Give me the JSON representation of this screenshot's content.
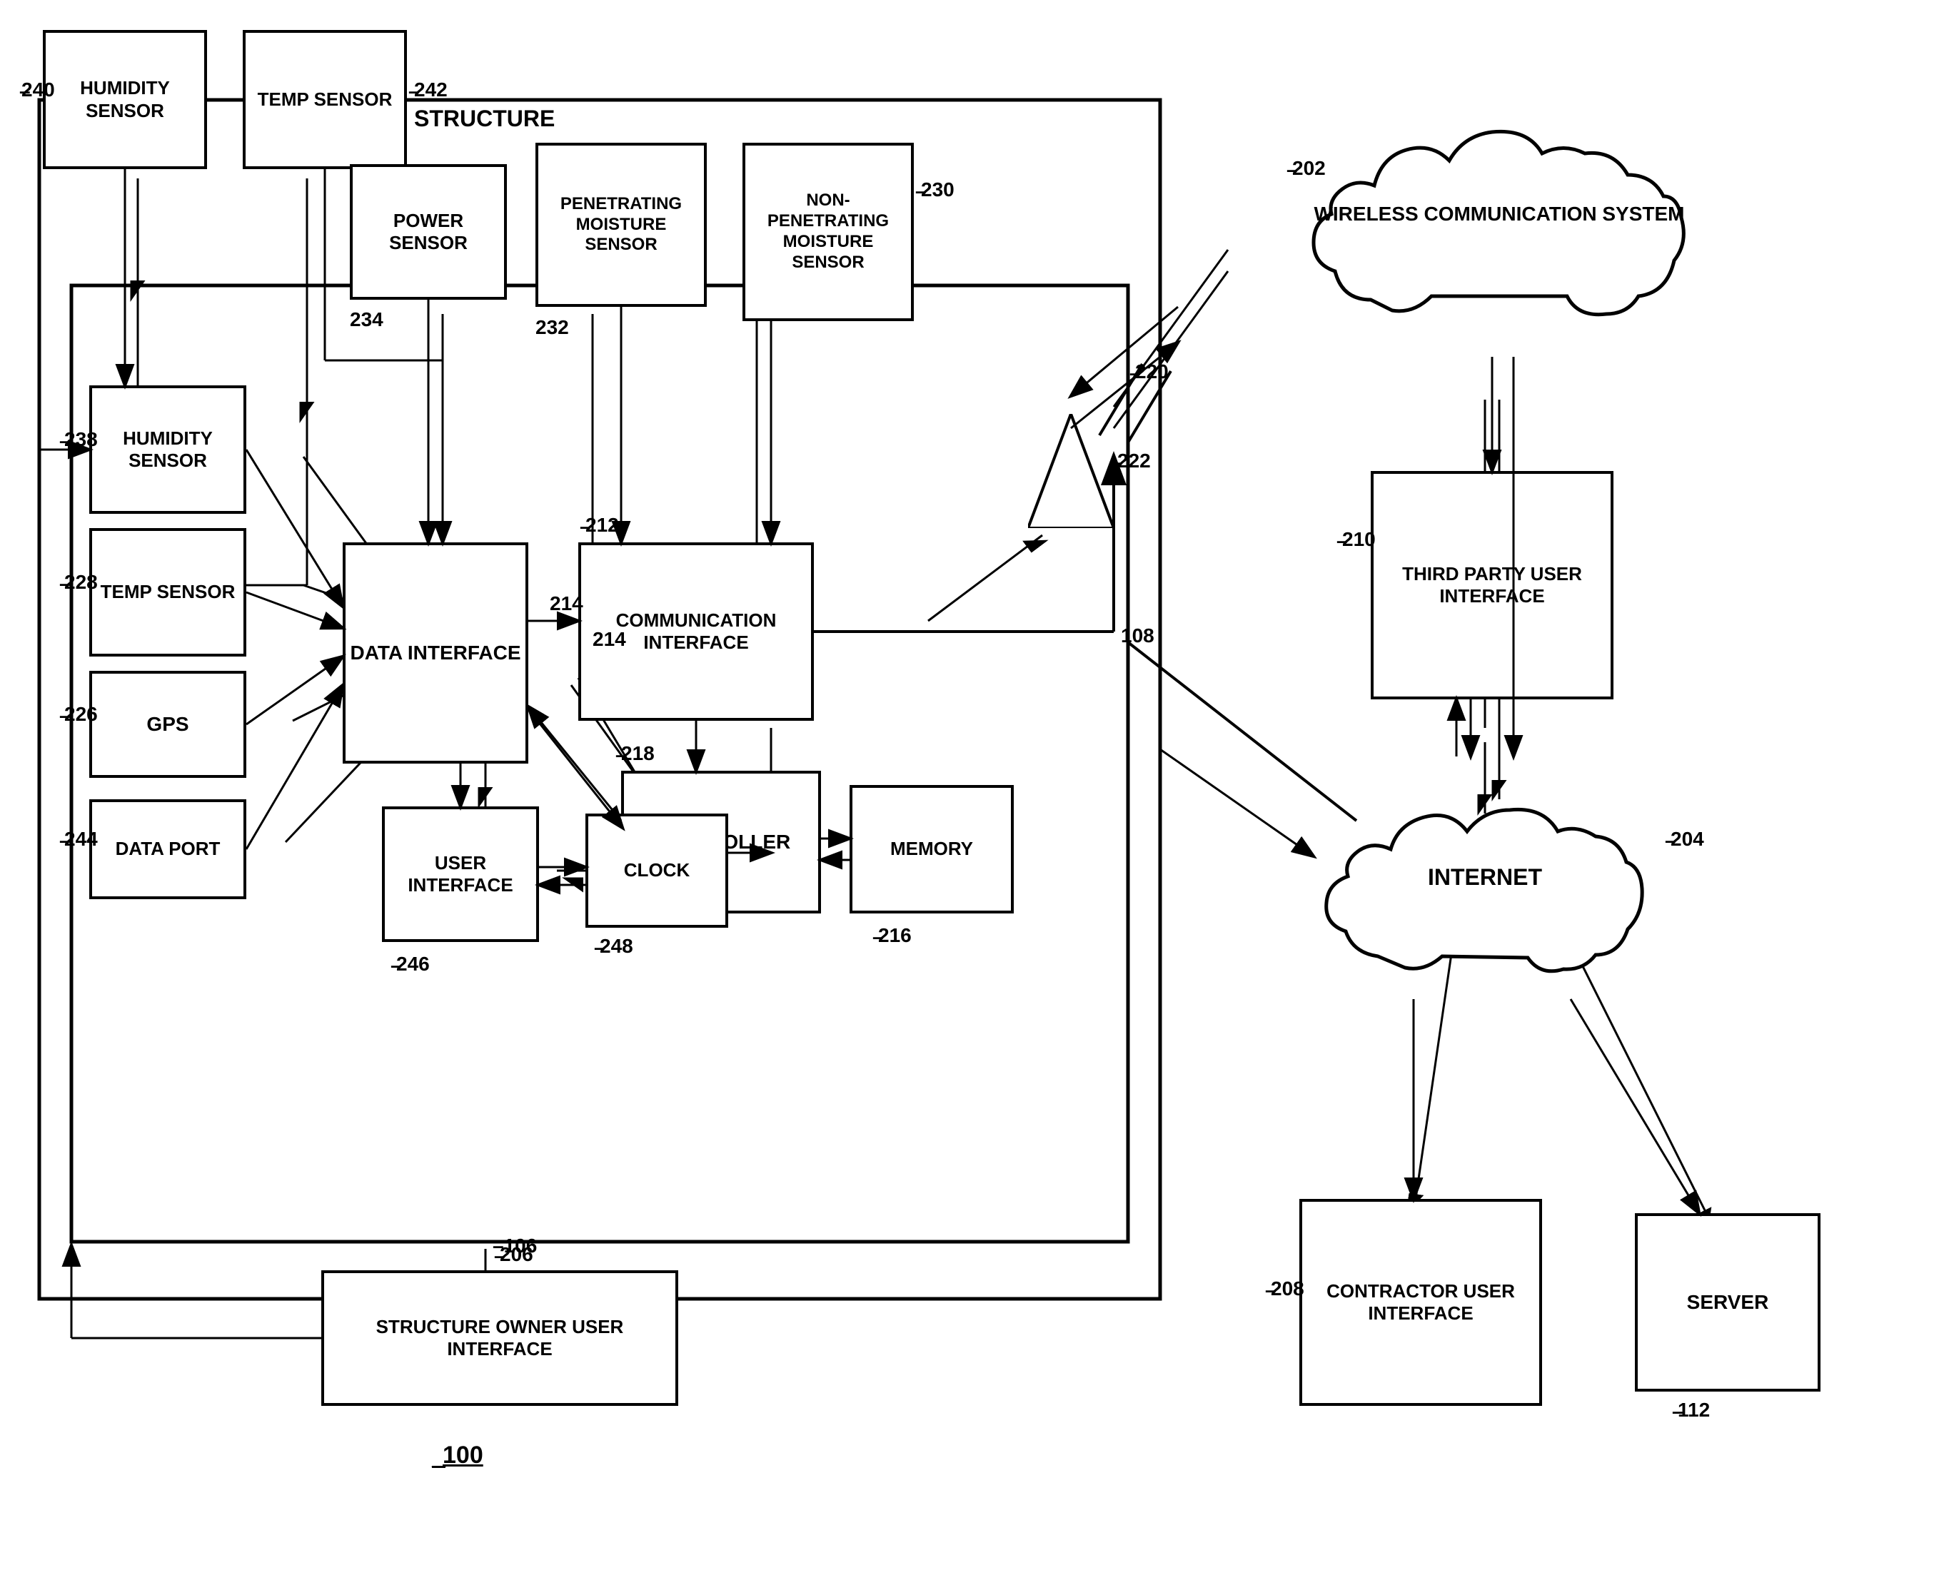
{
  "diagram": {
    "title_bottom": "100",
    "structure_label": "STRUCTURE",
    "structure_label_ref": "106",
    "nodes": {
      "humidity_sensor_outer": {
        "label": "HUMIDITY\nSENSOR",
        "ref": "240"
      },
      "temp_sensor_outer": {
        "label": "TEMP\nSENSOR",
        "ref": "242"
      },
      "power_sensor": {
        "label": "POWER\nSENSOR",
        "ref": "234"
      },
      "penetrating_moisture": {
        "label": "PENETRATING\nMOISTURE\nSENSOR",
        "ref": "232"
      },
      "non_penetrating_moisture": {
        "label": "NON-\nPENETRATING\nMOISTURE\nSENSOR",
        "ref": "230"
      },
      "humidity_sensor_inner": {
        "label": "HUMIDITY\nSENSOR",
        "ref": "238"
      },
      "temp_sensor_inner": {
        "label": "TEMP\nSENSOR",
        "ref": "228"
      },
      "gps": {
        "label": "GPS",
        "ref": "226"
      },
      "data_port": {
        "label": "DATA PORT",
        "ref": "244"
      },
      "data_interface": {
        "label": "DATA\nINTERFACE",
        "ref": ""
      },
      "communication_interface": {
        "label": "COMMUNICATION\nINTERFACE",
        "ref": "212"
      },
      "controller": {
        "label": "CONTROLLER",
        "ref": "218"
      },
      "memory": {
        "label": "MEMORY",
        "ref": "216"
      },
      "clock": {
        "label": "CLOCK",
        "ref": "248"
      },
      "user_interface_inner": {
        "label": "USER\nINTERFACE",
        "ref": "246"
      },
      "structure_owner_ui": {
        "label": "STRUCTURE OWNER\nUSER INTERFACE",
        "ref": "206"
      },
      "wireless_comm": {
        "label": "WIRELESS\nCOMMUNICATION\nSYSTEM",
        "ref": "202"
      },
      "third_party_ui": {
        "label": "THIRD PARTY\nUSER\nINTERFACE",
        "ref": "210"
      },
      "internet": {
        "label": "INTERNET",
        "ref": "204"
      },
      "contractor_ui": {
        "label": "CONTRACTOR\nUSER\nINTERFACE",
        "ref": "208"
      },
      "server": {
        "label": "SERVER",
        "ref": "112"
      },
      "antenna": {
        "ref": "222"
      },
      "bus108": {
        "ref": "108"
      },
      "bus214": {
        "ref": "214"
      }
    }
  }
}
